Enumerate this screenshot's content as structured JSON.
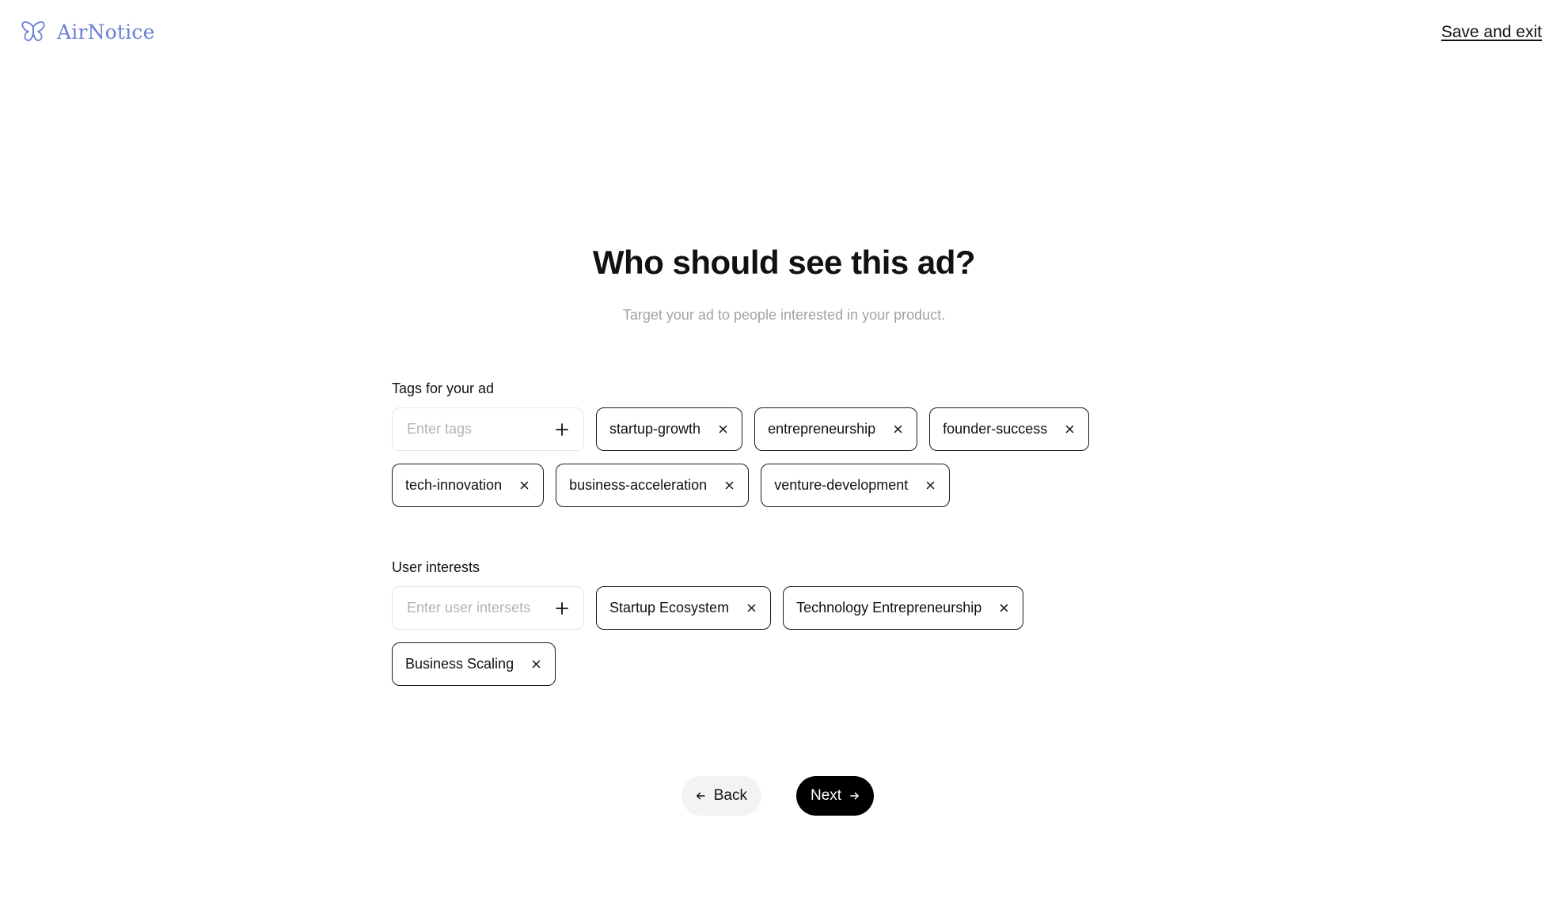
{
  "header": {
    "brand": "AirNotice",
    "save_exit": "Save and exit"
  },
  "main": {
    "title": "Who should see this ad?",
    "subtitle": "Target your ad to people interested in your product."
  },
  "tags_section": {
    "label": "Tags for your ad",
    "placeholder": "Enter tags",
    "tags": [
      "startup-growth",
      "entrepreneurship",
      "founder-success",
      "tech-innovation",
      "business-acceleration",
      "venture-development"
    ]
  },
  "interests_section": {
    "label": "User interests",
    "placeholder": "Enter user intersets",
    "interests": [
      "Startup Ecosystem",
      "Technology Entrepreneurship",
      "Business Scaling"
    ]
  },
  "nav": {
    "back_label": "Back",
    "next_label": "Next"
  },
  "colors": {
    "brand": "#6b7fd4",
    "next_button": "#000000",
    "back_button": "#f3f3f3",
    "subtitle": "#a3a3a3"
  },
  "icons": {
    "logo": "butterfly-icon",
    "add": "plus-icon",
    "remove": "close-icon",
    "back": "arrow-left-icon",
    "next": "arrow-right-icon"
  }
}
